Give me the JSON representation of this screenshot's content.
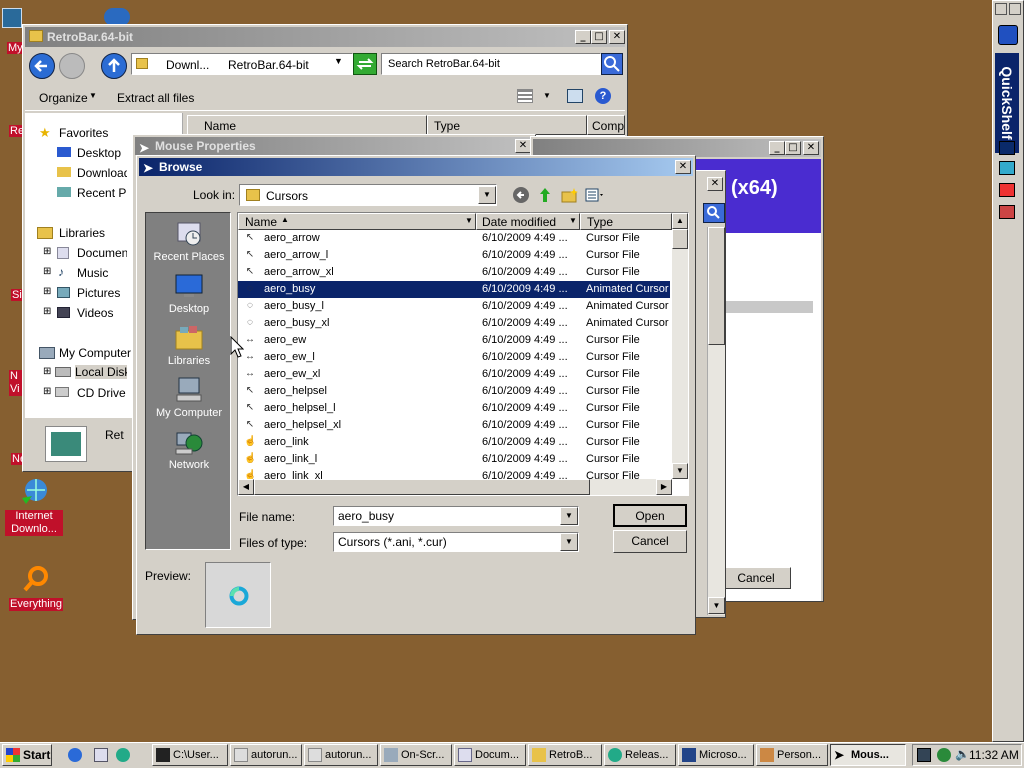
{
  "colors": {
    "desktop": "#865f30",
    "selection": "#0a246a",
    "desktop_label_bg": "#c0102a",
    "banner": "#4a2cd0"
  },
  "desktop_icons": [
    {
      "label": "Internet Downlo...",
      "icon": "download-globe-icon"
    },
    {
      "label": "Everything",
      "icon": "search-ring-icon"
    }
  ],
  "desktop_edge_labels": [
    "My",
    "Re",
    "Si",
    "N Vi",
    "Ne"
  ],
  "explorer": {
    "title": "RetroBar.64-bit",
    "path": [
      "Downl...",
      "RetroBar.64-bit"
    ],
    "search_placeholder": "Search RetroBar.64-bit",
    "organize": "Organize",
    "extract": "Extract all files",
    "columns": [
      "Name",
      "Type",
      "Compre"
    ],
    "nav": {
      "favorites": "Favorites",
      "desktop": "Desktop",
      "downloads": "Downloads",
      "recent": "Recent Places",
      "libraries": "Libraries",
      "documents": "Documents",
      "music": "Music",
      "pictures": "Pictures",
      "videos": "Videos",
      "computer": "My Computer",
      "local_disk": "Local Disk",
      "cd_drive": "CD Drive"
    },
    "detail_text": "Ret"
  },
  "mouse_props": {
    "title": "Mouse Properties",
    "banner_text": "(x64)",
    "cancel": "Cancel"
  },
  "browse": {
    "title": "Browse",
    "look_in_label": "Look in:",
    "look_in_value": "Cursors",
    "columns": {
      "name": "Name",
      "date": "Date modified",
      "type": "Type"
    },
    "places": [
      "Recent Places",
      "Desktop",
      "Libraries",
      "My Computer",
      "Network"
    ],
    "files": [
      {
        "name": "aero_arrow",
        "date": "6/10/2009 4:49 ...",
        "type": "Cursor File"
      },
      {
        "name": "aero_arrow_l",
        "date": "6/10/2009 4:49 ...",
        "type": "Cursor File"
      },
      {
        "name": "aero_arrow_xl",
        "date": "6/10/2009 4:49 ...",
        "type": "Cursor File"
      },
      {
        "name": "aero_busy",
        "date": "6/10/2009 4:49 ...",
        "type": "Animated Cursor"
      },
      {
        "name": "aero_busy_l",
        "date": "6/10/2009 4:49 ...",
        "type": "Animated Cursor"
      },
      {
        "name": "aero_busy_xl",
        "date": "6/10/2009 4:49 ...",
        "type": "Animated Cursor"
      },
      {
        "name": "aero_ew",
        "date": "6/10/2009 4:49 ...",
        "type": "Cursor File"
      },
      {
        "name": "aero_ew_l",
        "date": "6/10/2009 4:49 ...",
        "type": "Cursor File"
      },
      {
        "name": "aero_ew_xl",
        "date": "6/10/2009 4:49 ...",
        "type": "Cursor File"
      },
      {
        "name": "aero_helpsel",
        "date": "6/10/2009 4:49 ...",
        "type": "Cursor File"
      },
      {
        "name": "aero_helpsel_l",
        "date": "6/10/2009 4:49 ...",
        "type": "Cursor File"
      },
      {
        "name": "aero_helpsel_xl",
        "date": "6/10/2009 4:49 ...",
        "type": "Cursor File"
      },
      {
        "name": "aero_link",
        "date": "6/10/2009 4:49 ...",
        "type": "Cursor File"
      },
      {
        "name": "aero_link_l",
        "date": "6/10/2009 4:49 ...",
        "type": "Cursor File"
      },
      {
        "name": "aero_link_xl",
        "date": "6/10/2009 4:49 ...",
        "type": "Cursor File"
      }
    ],
    "selected_index": 3,
    "file_name_label": "File name:",
    "file_name_value": "aero_busy",
    "file_type_label": "Files of type:",
    "file_type_value": "Cursors (*.ani, *.cur)",
    "open": "Open",
    "cancel": "Cancel",
    "preview_label": "Preview:"
  },
  "quickshelf": {
    "label": "QuickShelf"
  },
  "taskbar": {
    "start": "Start",
    "tasks": [
      "C:\\User...",
      "autorun...",
      "autorun...",
      "On-Scr...",
      "Docum...",
      "RetroB...",
      "Releas...",
      "Microso...",
      "Person...",
      "Mous..."
    ],
    "active_index": 9,
    "clock": "11:32 AM"
  }
}
